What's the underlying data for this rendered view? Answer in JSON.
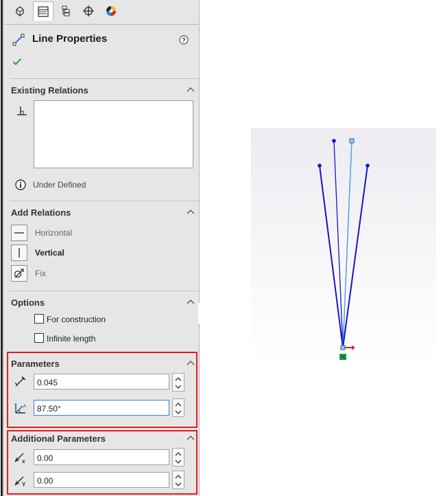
{
  "property_manager": {
    "tabs": [
      {
        "name": "feature-manager-icon",
        "active": false
      },
      {
        "name": "property-manager-icon",
        "active": true
      },
      {
        "name": "configuration-manager-icon",
        "active": false
      },
      {
        "name": "dimxpert-manager-icon",
        "active": false
      },
      {
        "name": "display-manager-icon",
        "active": false
      }
    ],
    "title": "Line Properties",
    "existing_relations": {
      "title": "Existing Relations",
      "status": "Under Defined"
    },
    "add_relations": {
      "title": "Add Relations",
      "items": [
        {
          "label": "Horizontal",
          "icon": "horizontal-relation-icon"
        },
        {
          "label": "Vertical",
          "icon": "vertical-relation-icon"
        },
        {
          "label": "Fix",
          "icon": "fix-relation-icon"
        }
      ]
    },
    "options": {
      "title": "Options",
      "items": [
        {
          "label": "For construction",
          "checked": false
        },
        {
          "label": "Infinite length",
          "checked": false
        }
      ]
    },
    "parameters": {
      "title": "Parameters",
      "length_value": "0.045",
      "angle_value": "87.50°"
    },
    "additional_parameters": {
      "title": "Additional Parameters",
      "delta_x_value": "0.00",
      "delta_y_value": "0.00"
    }
  },
  "colors": {
    "highlight": "#e01f1f",
    "sketch_line": "#1414c8",
    "selected_line": "#5aa0e6",
    "origin_arrow": "#e01f1f",
    "origin_point": "#1aa04a"
  }
}
